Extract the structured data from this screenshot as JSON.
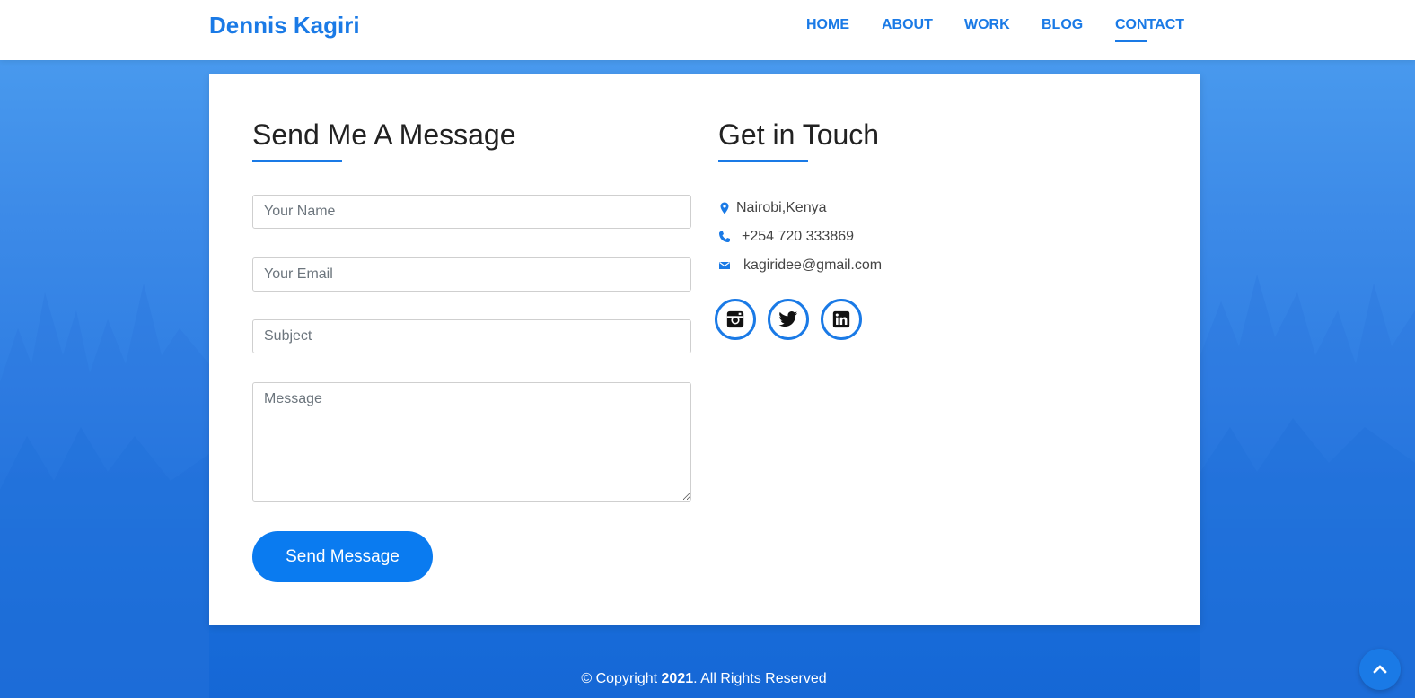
{
  "header": {
    "brand": "Dennis Kagiri",
    "nav": [
      {
        "label": "HOME",
        "icon": ""
      },
      {
        "label": "ABOUT",
        "icon": ""
      },
      {
        "label": "WORK",
        "icon": ""
      },
      {
        "label": "BLOG",
        "icon": ""
      },
      {
        "label": "CONTACT",
        "icon": ""
      }
    ],
    "active_nav": "CONTACT"
  },
  "form": {
    "title": "Send Me A Message",
    "fields": {
      "name": {
        "placeholder": "Your Name",
        "value": ""
      },
      "email": {
        "placeholder": "Your Email",
        "value": ""
      },
      "subject": {
        "placeholder": "Subject",
        "value": ""
      },
      "message": {
        "placeholder": "Message",
        "value": ""
      }
    },
    "submit_label": "Send Message"
  },
  "contact": {
    "title": "Get in Touch",
    "location": {
      "text": "Nairobi,Kenya",
      "icon": "map-pin-icon"
    },
    "phone": {
      "text": "+254 720 333869",
      "icon": "phone-icon"
    },
    "email": {
      "text": "kagiridee@gmail.com",
      "icon": "envelope-icon"
    },
    "social": [
      {
        "icon": "instagram-icon"
      },
      {
        "icon": "twitter-icon"
      },
      {
        "icon": "linkedin-icon"
      }
    ]
  },
  "footer": {
    "prefix": "© Copyright ",
    "year": "2021",
    "suffix": ". All Rights Reserved"
  },
  "back_to_top": {
    "icon": "chevron-up-icon"
  },
  "colors": {
    "accent": "#1a7ae6",
    "button": "#0a7bf0",
    "background_top": "#4d9ff0",
    "background_bottom": "#1567d6",
    "card": "#ffffff"
  }
}
